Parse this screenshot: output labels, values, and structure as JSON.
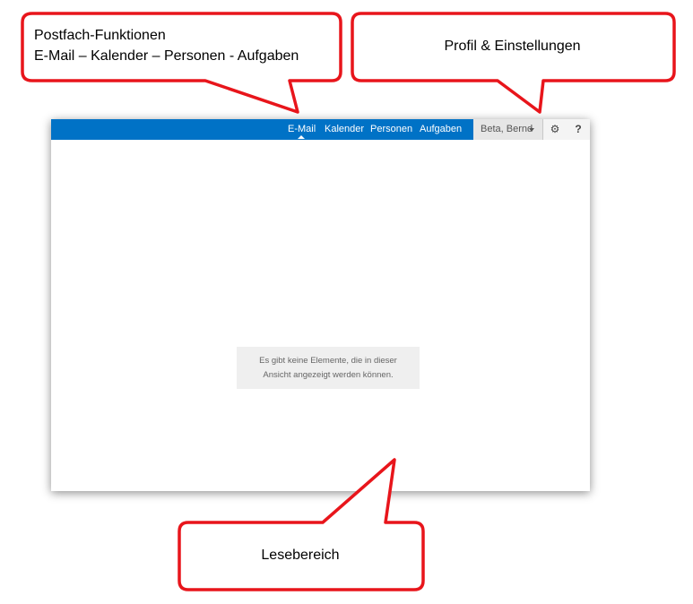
{
  "nav": {
    "email": "E-Mail",
    "calendar": "Kalender",
    "people": "Personen",
    "tasks": "Aufgaben"
  },
  "profile": {
    "name": "Beta, Bernd"
  },
  "icons": {
    "settings": "gear-icon",
    "help": "?"
  },
  "reading_pane": {
    "empty_line1": "Es gibt keine Elemente, die in dieser",
    "empty_line2": "Ansicht angezeigt werden können."
  },
  "callouts": {
    "mailbox_title": "Postfach-Funktionen",
    "mailbox_subtitle": "E-Mail – Kalender – Personen - Aufgaben",
    "profile": "Profil & Einstellungen",
    "reading": "Lesebereich"
  },
  "colors": {
    "topbar": "#0072c6",
    "callout_border": "#e8151b"
  }
}
